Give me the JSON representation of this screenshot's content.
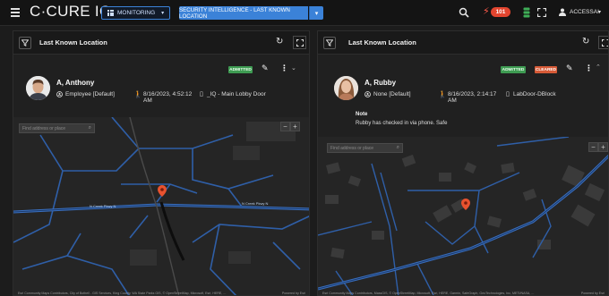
{
  "app": {
    "brand": "C·CURE IQ",
    "monitoring_label": "MONITORING",
    "active_view_label": "SECURITY INTELLIGENCE - LAST KNOWN LOCATION",
    "alarm_count": "101",
    "user_name": "ACCESSAI"
  },
  "panels": [
    {
      "title": "Last Known Location",
      "person": {
        "name": "A, Anthony",
        "role": "Employee [Default]",
        "datetime": "8/16/2023, 4:52:12 AM",
        "door": "_IQ - Main Lobby Door",
        "status_badges": [
          "ADMITTED"
        ]
      },
      "map": {
        "search_placeholder": "Find address or place",
        "road_labels": [
          "N Creek Pkwy N",
          "N Creek Pkwy N"
        ],
        "attribution": "Esri Community Maps Contributors, City of Bothell - GIS Services, King County, WA State Parks GIS, © OpenStreetMap, Microsoft, Esri, HERE, ...",
        "powered_by": "Powered by Esri"
      }
    },
    {
      "title": "Last Known Location",
      "person": {
        "name": "A, Rubby",
        "role": "None [Default]",
        "datetime": "8/16/2023, 2:14:17 AM",
        "door": "LabDoor-DBlock",
        "status_badges": [
          "ADMITTED",
          "CLEARED"
        ],
        "note_label": "Note",
        "note_text": "Rubby has checked in via phone. Safe"
      },
      "map": {
        "search_placeholder": "Find address or place",
        "attribution": "Esri Community Maps Contributors, MassGIS, © OpenStreetMap, Microsoft, Esri, HERE, Garmin, SafeGraph, GeoTechnologies, Inc, METI/NASA, ...",
        "powered_by": "Powered by Esri"
      }
    }
  ],
  "colors": {
    "accent": "#3b82d8",
    "alarm": "#e2452f",
    "admitted": "#3e9b52",
    "cleared": "#d65a37",
    "road": "#2f5fa8",
    "pin": "#e8522f"
  },
  "icons": {
    "menu": "hamburger-icon",
    "search": "search-icon",
    "alarm": "lightning-icon",
    "database": "database-icon",
    "fullscreen": "fullscreen-icon",
    "user": "user-icon"
  }
}
